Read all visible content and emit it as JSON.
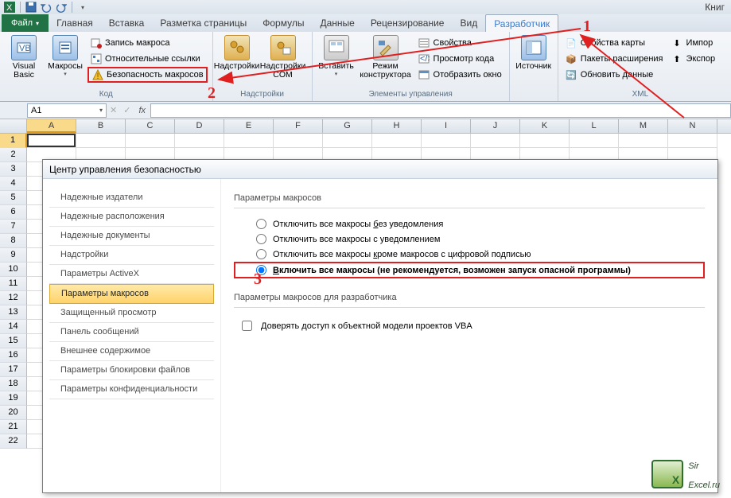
{
  "window": {
    "title": "Книг"
  },
  "tabs": {
    "file": "Файл",
    "items": [
      "Главная",
      "Вставка",
      "Разметка страницы",
      "Формулы",
      "Данные",
      "Рецензирование",
      "Вид",
      "Разработчик"
    ],
    "active_index": 7
  },
  "ribbon": {
    "code": {
      "vb": "Visual\nBasic",
      "macros": "Макросы",
      "rec": "Запись макроса",
      "rel": "Относительные ссылки",
      "sec": "Безопасность макросов",
      "group": "Код"
    },
    "addins": {
      "addins": "Надстройки",
      "com": "Надстройки\nCOM",
      "group": "Надстройки"
    },
    "controls": {
      "insert": "Вставить",
      "design": "Режим\nконструктора",
      "props": "Свойства",
      "viewcode": "Просмотр кода",
      "showwin": "Отобразить окно",
      "group": "Элементы управления"
    },
    "src": {
      "source": "Источник"
    },
    "xml": {
      "mapprops": "Свойства карты",
      "exp": "Пакеты расширения",
      "upd": "Обновить данные",
      "import": "Импор",
      "export": "Экспор",
      "group": "XML"
    }
  },
  "formula_bar": {
    "name": "A1"
  },
  "grid": {
    "cols": [
      "A",
      "B",
      "C",
      "D",
      "E",
      "F",
      "G",
      "H",
      "I",
      "J",
      "K",
      "L",
      "M",
      "N"
    ],
    "rows": 22
  },
  "dialog": {
    "title": "Центр управления безопасностью",
    "nav": [
      "Надежные издатели",
      "Надежные расположения",
      "Надежные документы",
      "Надстройки",
      "Параметры ActiveX",
      "Параметры макросов",
      "Защищенный просмотр",
      "Панель сообщений",
      "Внешнее содержимое",
      "Параметры блокировки файлов",
      "Параметры конфиденциальности"
    ],
    "nav_selected": 5,
    "sec1_head": "Параметры макросов",
    "radios": [
      "Отключить все макросы без уведомления",
      "Отключить все макросы с уведомлением",
      "Отключить все макросы кроме макросов с цифровой подписью",
      "Включить все макросы (не рекомендуется, возможен запуск опасной программы)"
    ],
    "radio_checked": 3,
    "sec2_head": "Параметры макросов для разработчика",
    "chk": "Доверять доступ к объектной модели проектов VBA"
  },
  "annotations": {
    "n1": "1",
    "n2": "2",
    "n3": "3"
  },
  "watermark": {
    "l1": "Sir",
    "l2": "Excel.ru"
  }
}
